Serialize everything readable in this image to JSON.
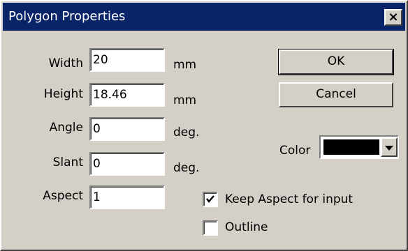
{
  "window": {
    "title": "Polygon Properties",
    "close_glyph": "×"
  },
  "fields": [
    {
      "label": "Width",
      "value": "20",
      "unit": "mm"
    },
    {
      "label": "Height",
      "value": "18.46",
      "unit": "mm"
    },
    {
      "label": "Angle",
      "value": "0",
      "unit": "deg."
    },
    {
      "label": "Slant",
      "value": "0",
      "unit": "deg."
    },
    {
      "label": "Aspect",
      "value": "1",
      "unit": ""
    }
  ],
  "buttons": {
    "ok": "OK",
    "cancel": "Cancel"
  },
  "color": {
    "label": "Color",
    "value_hex": "#000000"
  },
  "options": [
    {
      "label": "Keep Aspect for input",
      "checked": true
    },
    {
      "label": "Outline",
      "checked": false
    }
  ],
  "colors": {
    "titlebar": "#0a246a",
    "face": "#d4d0c8"
  },
  "icons": {
    "close": "close-icon",
    "dropdown": "chevron-down-icon",
    "check": "checkmark-icon"
  }
}
